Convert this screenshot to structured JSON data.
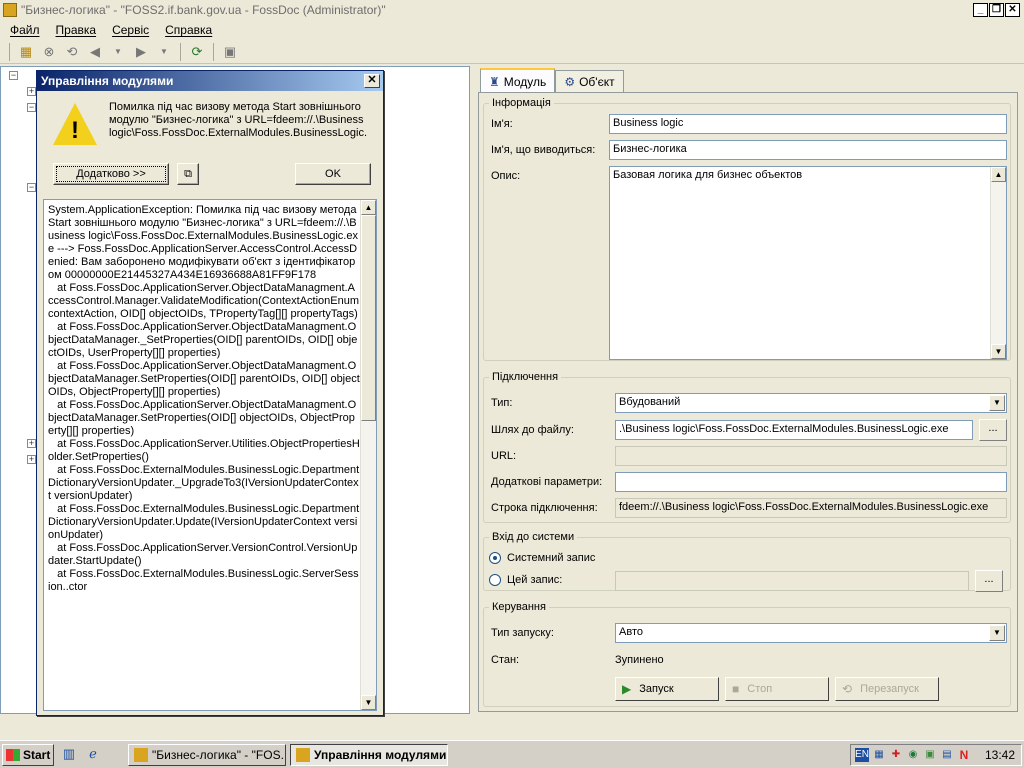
{
  "window": {
    "title": "\"Бизнес-логика\" - \"FOSS2.if.bank.gov.ua - FossDoc (Administrator)\""
  },
  "menu": [
    "Файл",
    "Правка",
    "Сервіс",
    "Справка"
  ],
  "dialog": {
    "title": "Управління модулями",
    "message": "Помилка під час визову метода Start зовнішнього модулю \"Бизнес-логика\" з URL=fdeem://.\\Business logic\\Foss.FossDoc.ExternalModules.BusinessLogic.exe",
    "details_button": "Додатково >>",
    "ok_button": "OK",
    "details": "System.ApplicationException: Помилка під час визову метода Start зовнішнього модулю \"Бизнес-логика\" з URL=fdeem://.\\Business logic\\Foss.FossDoc.ExternalModules.BusinessLogic.exe ---> Foss.FossDoc.ApplicationServer.AccessControl.AccessDenied: Вам заборонено модифікувати об'єкт з ідентифікатором 00000000E21445327A434E16936688A81FF9F178\n   at Foss.FossDoc.ApplicationServer.ObjectDataManagment.AccessControl.Manager.ValidateModification(ContextActionEnum contextAction, OID[] objectOIDs, TPropertyTag[][] propertyTags)\n   at Foss.FossDoc.ApplicationServer.ObjectDataManagment.ObjectDataManager._SetProperties(OID[] parentOIDs, OID[] objectOIDs, UserProperty[][] properties)\n   at Foss.FossDoc.ApplicationServer.ObjectDataManagment.ObjectDataManager.SetProperties(OID[] parentOIDs, OID[] objectOIDs, ObjectProperty[][] properties)\n   at Foss.FossDoc.ApplicationServer.ObjectDataManagment.ObjectDataManager.SetProperties(OID[] objectOIDs, ObjectProperty[][] properties)\n   at Foss.FossDoc.ApplicationServer.Utilities.ObjectPropertiesHolder.SetProperties()\n   at Foss.FossDoc.ExternalModules.BusinessLogic.DepartmentDictionaryVersionUpdater._UpgradeTo3(IVersionUpdaterContext versionUpdater)\n   at Foss.FossDoc.ExternalModules.BusinessLogic.DepartmentDictionaryVersionUpdater.Update(IVersionUpdaterContext versionUpdater)\n   at Foss.FossDoc.ApplicationServer.VersionControl.VersionUpdater.StartUpdate()\n   at Foss.FossDoc.ExternalModules.BusinessLogic.ServerSession..ctor"
  },
  "tabs": [
    {
      "label": "Модуль",
      "icon": "module-icon"
    },
    {
      "label": "Об'єкт",
      "icon": "gear-icon"
    }
  ],
  "info": {
    "legend": "Інформація",
    "name_label": "Ім'я:",
    "name_value": "Business logic",
    "display_label": "Ім'я, що виводиться:",
    "display_value": "Бизнес-логика",
    "desc_label": "Опис:",
    "desc_value": "Базовая логика для бизнес объектов"
  },
  "connection": {
    "legend": "Підключення",
    "type_label": "Тип:",
    "type_value": "Вбудований",
    "path_label": "Шлях до файлу:",
    "path_value": ".\\Business logic\\Foss.FossDoc.ExternalModules.BusinessLogic.exe",
    "url_label": "URL:",
    "url_value": "",
    "params_label": "Додаткові параметри:",
    "params_value": "",
    "conn_label": "Строка підключення:",
    "conn_value": "fdeem://.\\Business logic\\Foss.FossDoc.ExternalModules.BusinessLogic.exe",
    "browse_label": "..."
  },
  "login": {
    "legend": "Вхід до системи",
    "system_label": "Системний запис",
    "this_label": "Цей запис:",
    "browse_label": "..."
  },
  "control": {
    "legend": "Керування",
    "start_type_label": "Тип запуску:",
    "start_type_value": "Авто",
    "state_label": "Стан:",
    "state_value": "Зупинено",
    "start_button": "Запуск",
    "stop_button": "Стоп",
    "restart_button": "Перезапуск"
  },
  "taskbar": {
    "start": "Start",
    "tasks": [
      {
        "label": "\"Бизнес-логика\" - \"FOS..."
      },
      {
        "label": "Управління модулями"
      }
    ],
    "lang": "EN",
    "clock": "13:42"
  }
}
